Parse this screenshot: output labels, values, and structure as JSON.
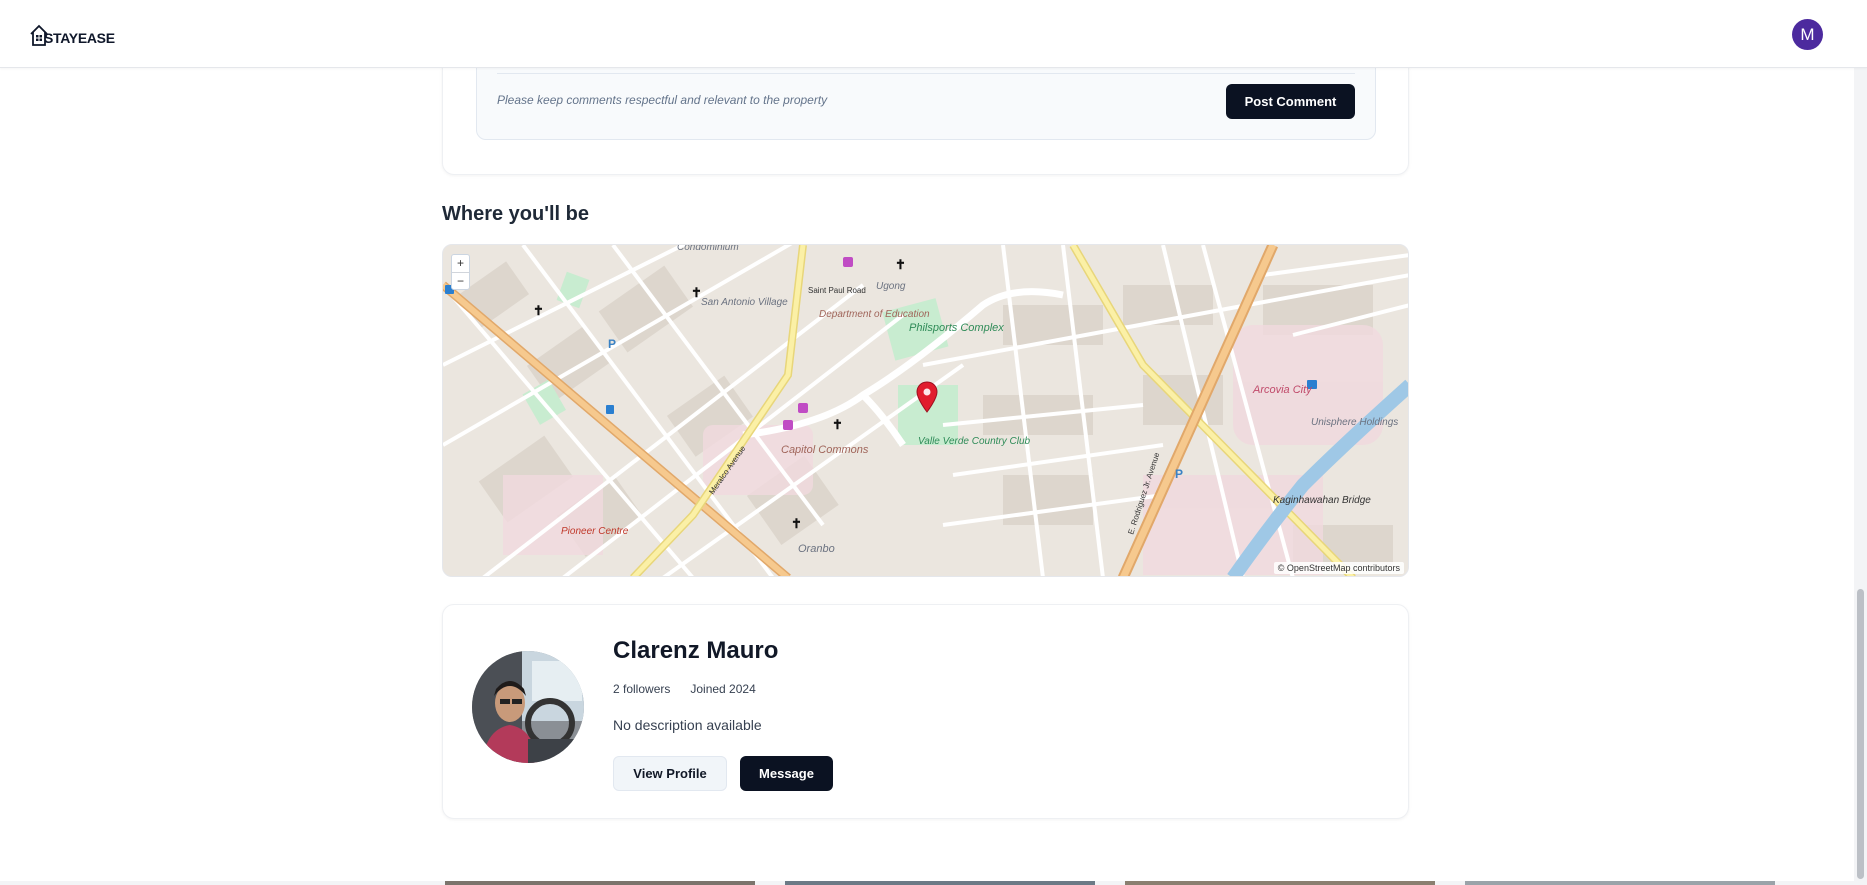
{
  "header": {
    "brand": "STAYEASE",
    "user_initial": "M"
  },
  "comments": {
    "hint": "Please keep comments respectful and relevant to the property",
    "post_label": "Post Comment"
  },
  "location": {
    "title": "Where you'll be",
    "zoom_in": "+",
    "zoom_out": "−",
    "attribution": "© OpenStreetMap contributors",
    "map_labels": {
      "philsports": "Philsports Complex",
      "capitol": "Capitol Commons",
      "arcovia": "Arcovia City",
      "oranbo": "Oranbo",
      "valle_verde": "Valle Verde Country Club",
      "san_antonio": "San Antonio Village",
      "pioneer": "Pioneer Centre",
      "kaginhawahan": "Kaginhawahan Bridge",
      "unisphere": "Unisphere Holdings",
      "saint_paul": "Saint Paul Road",
      "meralco": "Meralco Avenue",
      "rodriguez": "E. Rodriguez Jr. Avenue",
      "dept_ed": "Department of Education",
      "condominium": "Condominium",
      "ugong": "Ugong"
    }
  },
  "host": {
    "name": "Clarenz Mauro",
    "followers": "2 followers",
    "joined": "Joined 2024",
    "description": "No description available",
    "view_profile_label": "View Profile",
    "message_label": "Message"
  },
  "colors": {
    "primary_dark": "#0b1222",
    "avatar_purple": "#4c2a9e",
    "map_pin": "#e11d2e"
  }
}
